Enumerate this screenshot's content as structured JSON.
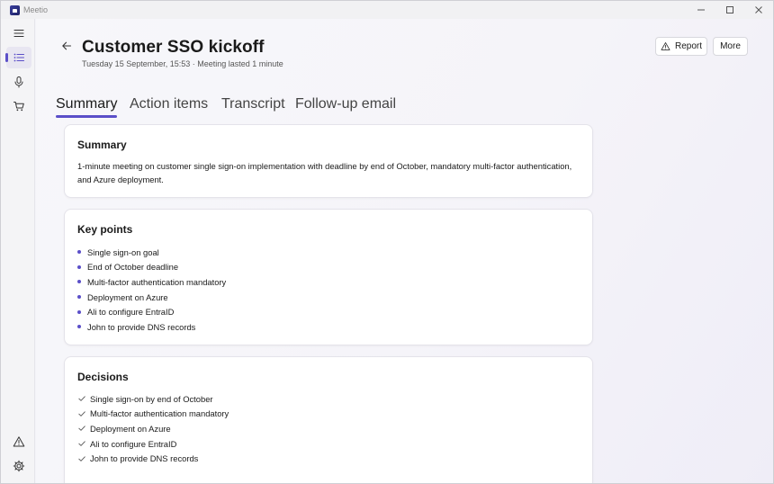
{
  "app": {
    "title": "Meetio"
  },
  "window_controls": {
    "minimize": "—",
    "maximize": "☐",
    "close": "✕"
  },
  "rail": {
    "items": [
      {
        "name": "menu",
        "icon": "hamburger-icon"
      },
      {
        "name": "meetings",
        "icon": "list-icon",
        "active": true
      },
      {
        "name": "record",
        "icon": "microphone-icon"
      },
      {
        "name": "store",
        "icon": "cart-icon"
      }
    ],
    "bottom": [
      {
        "name": "report",
        "icon": "warning-icon"
      },
      {
        "name": "settings",
        "icon": "gear-icon"
      }
    ]
  },
  "header": {
    "title": "Customer SSO kickoff",
    "subtitle": "Tuesday 15 September, 15:53 · Meeting lasted 1 minute",
    "report_label": "Report",
    "more_label": "More"
  },
  "tabs": [
    {
      "label": "Summary",
      "active": true
    },
    {
      "label": "Action items"
    },
    {
      "label": "Transcript"
    },
    {
      "label": "Follow-up email"
    }
  ],
  "summary": {
    "title": "Summary",
    "text": "1-minute meeting on customer single sign-on implementation with deadline by end of October, mandatory multi-factor authentication, and Azure deployment."
  },
  "key_points": {
    "title": "Key points",
    "items": [
      "Single sign-on goal",
      "End of October deadline",
      "Multi-factor authentication mandatory",
      "Deployment on Azure",
      "Ali to configure EntraID",
      "John to provide DNS records"
    ]
  },
  "decisions": {
    "title": "Decisions",
    "items": [
      "Single sign-on by end of October",
      "Multi-factor authentication mandatory",
      "Deployment on Azure",
      "Ali to configure EntraID",
      "John to provide DNS records"
    ]
  },
  "colors": {
    "accent": "#5b4fc8",
    "card": "#ffffff",
    "background": "#f5f4f9"
  }
}
